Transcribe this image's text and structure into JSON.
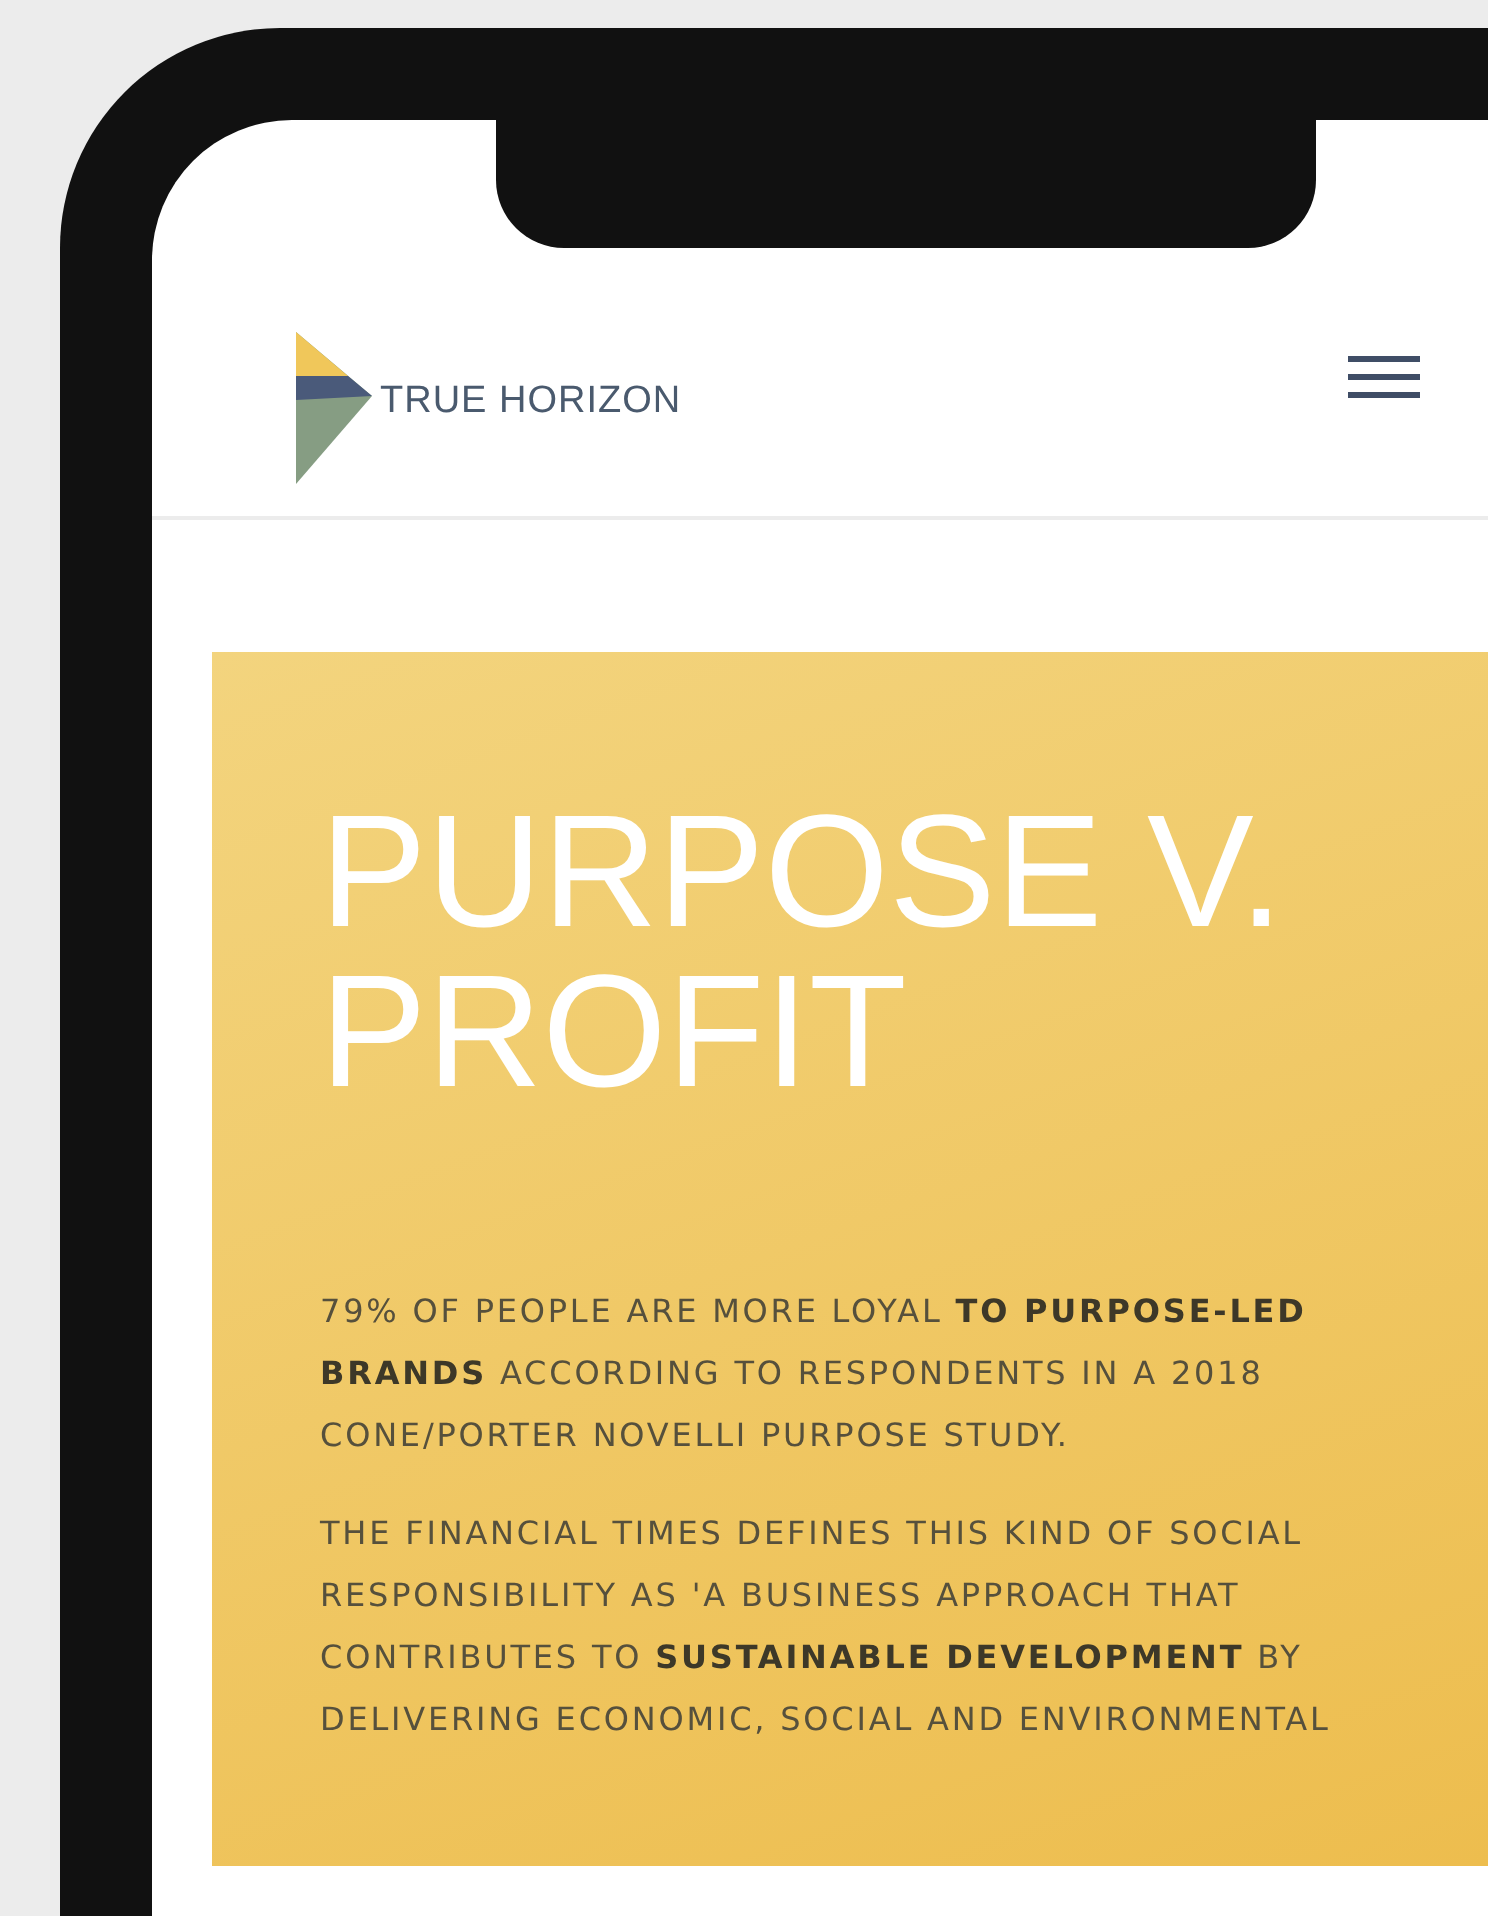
{
  "header": {
    "logo_text": "TRUE HORIZON"
  },
  "hero": {
    "title": "PURPOSE V. PROFIT",
    "paragraphs": [
      "79% OF PEOPLE ARE MORE LOYAL **TO PURPOSE-LED BRANDS** ACCORDING TO RESPONDENTS IN A 2018 CONE/PORTER NOVELLI PURPOSE STUDY.",
      "THE FINANCIAL TIMES DEFINES THIS KIND OF SOCIAL RESPONSIBILITY AS 'A BUSINESS APPROACH THAT CONTRIBUTES TO **SUSTAINABLE DEVELOPMENT** BY DELIVERING ECONOMIC, SOCIAL AND ENVIRONMENTAL"
    ]
  }
}
